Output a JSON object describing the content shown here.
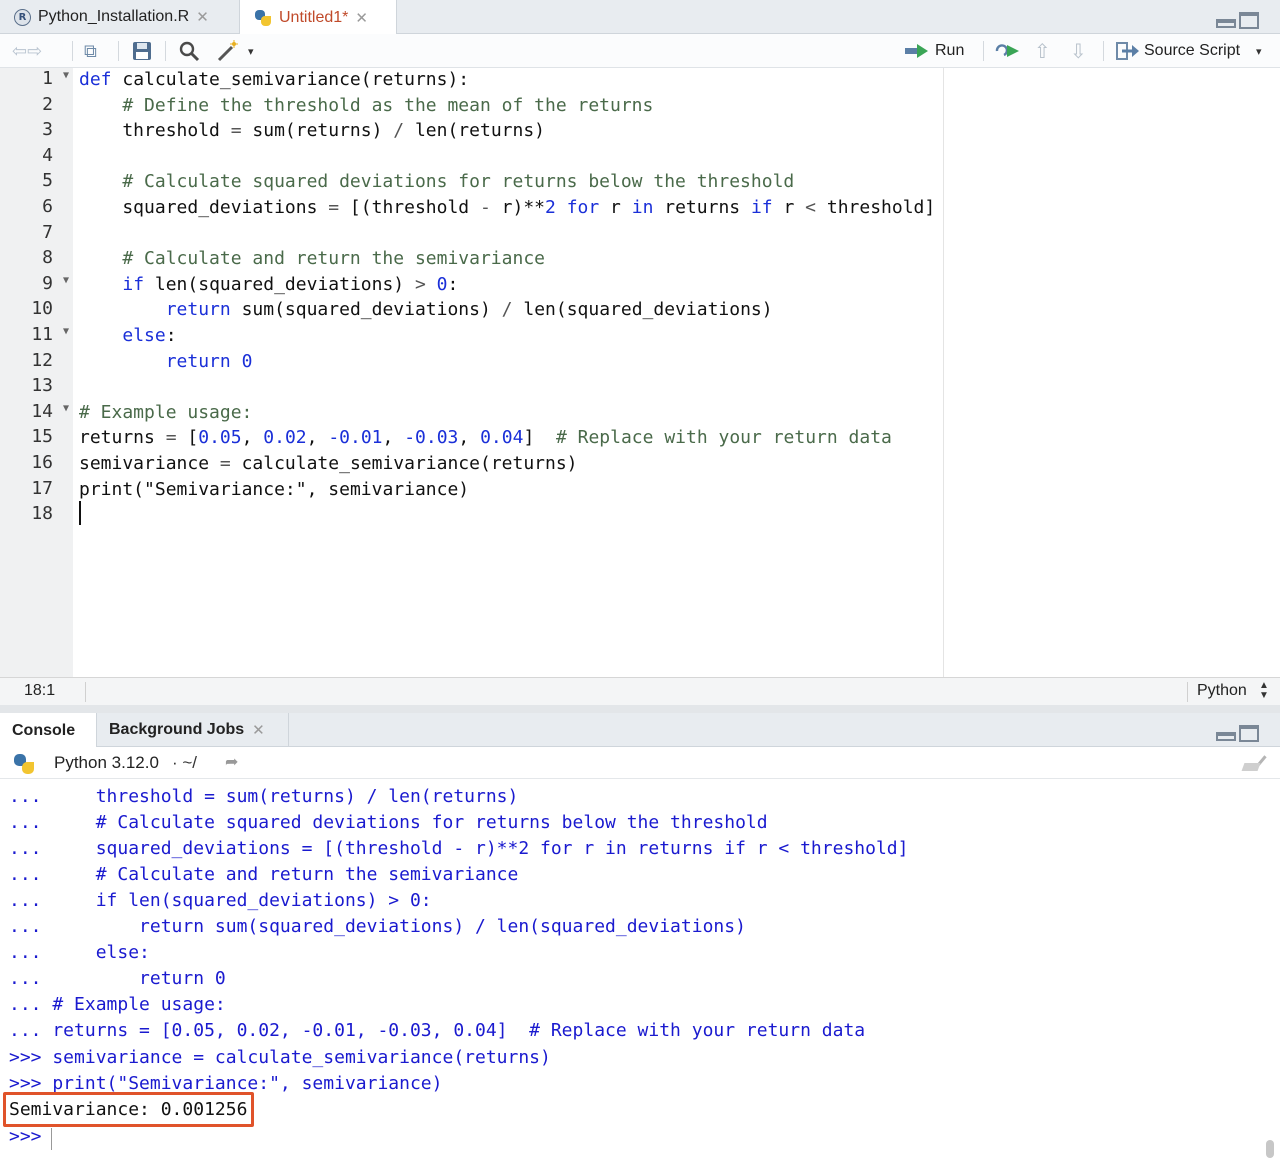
{
  "editor": {
    "tabs": [
      {
        "label": "Python_Installation.R",
        "icon": "r-file-icon",
        "active": false
      },
      {
        "label": "Untitled1*",
        "icon": "python-file-icon",
        "active": true
      }
    ],
    "toolbar": {
      "run_label": "Run",
      "source_label": "Source Script"
    },
    "code_lines": [
      {
        "n": "1",
        "fold": true
      },
      {
        "n": "2",
        "fold": false
      },
      {
        "n": "3",
        "fold": false
      },
      {
        "n": "4",
        "fold": false
      },
      {
        "n": "5",
        "fold": false
      },
      {
        "n": "6",
        "fold": false
      },
      {
        "n": "7",
        "fold": false
      },
      {
        "n": "8",
        "fold": false
      },
      {
        "n": "9",
        "fold": true
      },
      {
        "n": "10",
        "fold": false
      },
      {
        "n": "11",
        "fold": true
      },
      {
        "n": "12",
        "fold": false
      },
      {
        "n": "13",
        "fold": false
      },
      {
        "n": "14",
        "fold": true
      },
      {
        "n": "15",
        "fold": false
      },
      {
        "n": "16",
        "fold": false
      },
      {
        "n": "17",
        "fold": false
      },
      {
        "n": "18",
        "fold": false
      }
    ],
    "code": {
      "l1_kw": "def",
      "l1_rest": " calculate_semivariance(returns):",
      "l2": "    # Define the threshold as the mean of the returns",
      "l3_a": "    threshold ",
      "l3_b": "=",
      "l3_c": " sum(returns) ",
      "l3_d": "/",
      "l3_e": " len(returns)",
      "l5": "    # Calculate squared deviations for returns below the threshold",
      "l6_a": "    squared_deviations ",
      "l6_b": "=",
      "l6_c": " [(threshold ",
      "l6_d": "-",
      "l6_e": " r)**",
      "l6_f": "2",
      "l6_g": " ",
      "l6_h": "for",
      "l6_i": " r ",
      "l6_j": "in",
      "l6_k": " returns ",
      "l6_l": "if",
      "l6_m": " r ",
      "l6_n": "<",
      "l6_o": " threshold]",
      "l8": "    # Calculate and return the semivariance",
      "l9_a": "    ",
      "l9_kw": "if",
      "l9_b": " len(squared_deviations) ",
      "l9_c": ">",
      "l9_d": " ",
      "l9_e": "0",
      "l9_f": ":",
      "l10_a": "        ",
      "l10_kw": "return",
      "l10_b": " sum(squared_deviations) ",
      "l10_c": "/",
      "l10_d": " len(squared_deviations)",
      "l11_a": "    ",
      "l11_kw": "else",
      "l11_b": ":",
      "l12_a": "        ",
      "l12_kw": "return",
      "l12_b": " ",
      "l12_c": "0",
      "l14": "# Example usage:",
      "l15_a": "returns ",
      "l15_b": "=",
      "l15_c": " [",
      "l15_d": "0.05",
      "l15_e": ", ",
      "l15_f": "0.02",
      "l15_g": ", ",
      "l15_h": "-0.01",
      "l15_i": ", ",
      "l15_j": "-0.03",
      "l15_k": ", ",
      "l15_l": "0.04",
      "l15_m": "]  ",
      "l15_n": "# Replace with your return data",
      "l16_a": "semivariance ",
      "l16_b": "=",
      "l16_c": " calculate_semivariance(returns)",
      "l17_a": "print(",
      "l17_b": "\"Semivariance:\"",
      "l17_c": ", semivariance)"
    },
    "status": {
      "position": "18:1",
      "language": "Python"
    }
  },
  "console": {
    "tabs": [
      {
        "label": "Console",
        "active": true
      },
      {
        "label": "Background Jobs",
        "active": false
      }
    ],
    "interpreter": "Python 3.12.0",
    "working_dir": "· ~/",
    "lines": [
      "...     threshold = sum(returns) / len(returns)",
      "...     # Calculate squared deviations for returns below the threshold",
      "...     squared_deviations = [(threshold - r)**2 for r in returns if r < threshold]",
      "...     # Calculate and return the semivariance",
      "...     if len(squared_deviations) > 0:",
      "...         return sum(squared_deviations) / len(squared_deviations)",
      "...     else:",
      "...         return 0",
      "... # Example usage:",
      "... returns = [0.05, 0.02, -0.01, -0.03, 0.04]  # Replace with your return data",
      ">>> semivariance = calculate_semivariance(returns)",
      ">>> print(\"Semivariance:\", semivariance)"
    ],
    "output": "Semivariance: 0.001256",
    "prompt": ">>>"
  },
  "colors": {
    "keyword": "#1a2fd8",
    "comment": "#4a6a4a",
    "console_input": "#1a1acf",
    "highlight_box": "#e0532a",
    "active_tab_label": "#c04a2a"
  }
}
